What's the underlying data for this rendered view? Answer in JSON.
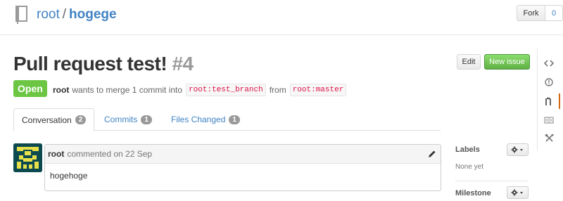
{
  "header": {
    "owner": "root",
    "separator": "/",
    "repo": "hogege",
    "fork_label": "Fork",
    "fork_count": "0"
  },
  "pr": {
    "title": "Pull request test!",
    "number": "#4",
    "edit_label": "Edit",
    "new_issue_label": "New issue",
    "state": "Open",
    "author": "root",
    "merge_text": "wants to merge 1 commit into",
    "base_branch": "root:test_branch",
    "from_text": "from",
    "head_branch": "root:master"
  },
  "tabs": [
    {
      "label": "Conversation",
      "count": "2"
    },
    {
      "label": "Commits",
      "count": "1"
    },
    {
      "label": "Files Changed",
      "count": "1"
    }
  ],
  "comment": {
    "author": "root",
    "meta": "commented on 22 Sep",
    "body": "hogehoge"
  },
  "sidebar": {
    "labels_heading": "Labels",
    "labels_value": "None yet",
    "milestone_heading": "Milestone"
  },
  "colors": {
    "link": "#4183c4",
    "open_badge": "#6cc644",
    "new_issue": "#60b044",
    "branch_text": "#dd1144",
    "selected_nav": "#d26911"
  },
  "icons": {
    "repo": "repo-book-icon",
    "nav": [
      "code-icon",
      "issues-icon",
      "pull-request-icon",
      "wiki-icon",
      "tools-icon"
    ]
  }
}
